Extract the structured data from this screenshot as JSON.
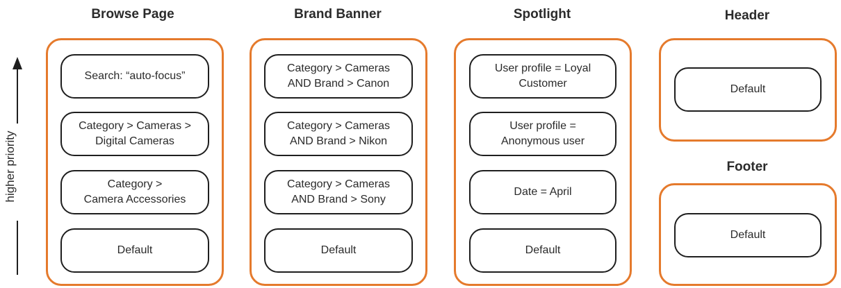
{
  "priority_axis": {
    "label": "higher priority"
  },
  "columns": [
    {
      "title": "Browse Page",
      "rules": [
        "Search: “auto-focus”",
        "Category > Cameras >\nDigital Cameras",
        "Category >\nCamera Accessories",
        "Default"
      ]
    },
    {
      "title": "Brand Banner",
      "rules": [
        "Category > Cameras\nAND Brand > Canon",
        "Category > Cameras\nAND Brand > Nikon",
        "Category > Cameras\nAND Brand > Sony",
        "Default"
      ]
    },
    {
      "title": "Spotlight",
      "rules": [
        "User profile = Loyal\nCustomer",
        "User profile =\nAnonymous user",
        "Date = April",
        "Default"
      ]
    },
    {
      "title": "Header",
      "rules": [
        "Default"
      ]
    },
    {
      "title": "Footer",
      "rules": [
        "Default"
      ]
    }
  ],
  "colors": {
    "panel_border": "#e57a2c",
    "rule_border": "#1e1e1e"
  }
}
